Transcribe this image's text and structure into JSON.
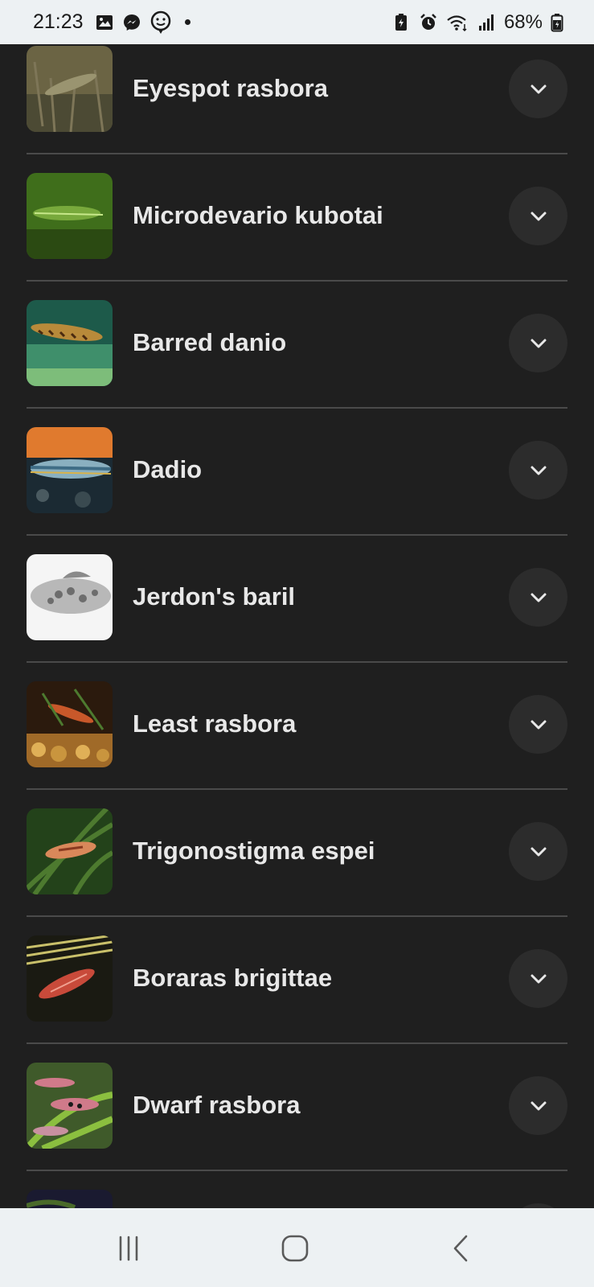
{
  "status_bar": {
    "time": "21:23",
    "left_icons": [
      "gallery-icon",
      "messenger-icon",
      "face-notification-icon",
      "dot-icon"
    ],
    "right_icons": [
      "battery-saver-icon",
      "alarm-icon",
      "wifi-icon",
      "signal-icon",
      "battery-icon"
    ],
    "battery_percent": "68%"
  },
  "fish_list": {
    "items": [
      {
        "name": "Eyespot rasbora",
        "thumb_colors": [
          "#6b6444",
          "#4c4a34",
          "#9a9470"
        ]
      },
      {
        "name": "Microdevario kubotai",
        "thumb_colors": [
          "#3f6e1b",
          "#78a93c",
          "#2b4a12"
        ]
      },
      {
        "name": "Barred danio",
        "thumb_colors": [
          "#1d5a4a",
          "#3f8f6b",
          "#7dbd7a"
        ]
      },
      {
        "name": "Dadio",
        "thumb_colors": [
          "#e07a2e",
          "#3f6d86",
          "#1b2a33"
        ]
      },
      {
        "name": "Jerdon's baril",
        "thumb_colors": [
          "#f5f5f5",
          "#b8b8b8",
          "#6d6d6d"
        ]
      },
      {
        "name": "Least rasbora",
        "thumb_colors": [
          "#2b1a0d",
          "#a06a28",
          "#e0b057"
        ]
      },
      {
        "name": "Trigonostigma espei",
        "thumb_colors": [
          "#23421a",
          "#4d7a2f",
          "#d9885a"
        ]
      },
      {
        "name": "Boraras brigittae",
        "thumb_colors": [
          "#1a1a12",
          "#7e7a3a",
          "#c84a3a"
        ]
      },
      {
        "name": "Dwarf rasbora",
        "thumb_colors": [
          "#3f5a2a",
          "#8bbf3f",
          "#d07a8a"
        ]
      },
      {
        "name": "",
        "thumb_colors": [
          "#1a1a30",
          "#4a6a2a",
          "#2a2a2a"
        ]
      }
    ]
  },
  "nav_bar": {
    "icons": [
      "recent-apps-icon",
      "home-icon",
      "back-icon"
    ]
  },
  "colors": {
    "background": "#1f1f1f",
    "text": "#e8e8e8",
    "button_bg": "#2c2c2c",
    "divider": "#4a4a4a",
    "system_bar": "#edf1f3"
  }
}
